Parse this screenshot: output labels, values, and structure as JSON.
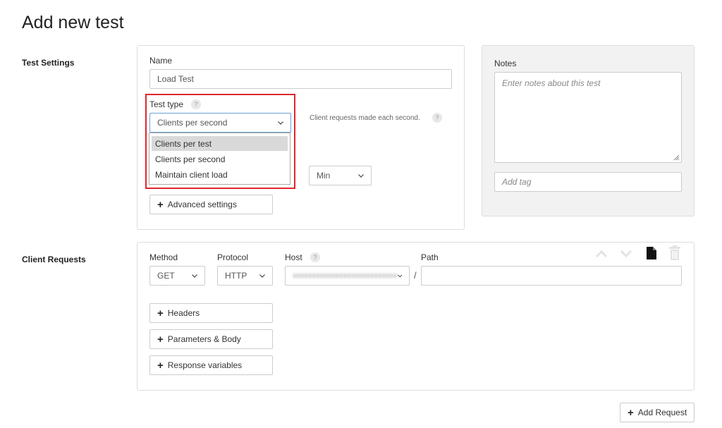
{
  "page": {
    "title": "Add new test"
  },
  "test_settings": {
    "section_label": "Test Settings",
    "name_label": "Name",
    "name_value": "Load Test",
    "test_type_label": "Test type",
    "test_type_help": "?",
    "test_type_selected": "Clients per second",
    "test_type_options": [
      "Clients per test",
      "Clients per second",
      "Maintain client load"
    ],
    "test_type_highlighted_option": "Clients per test",
    "hint": "Client requests made each second.",
    "hint_help": "?",
    "duration_unit_selected": "Min",
    "advanced_settings_label": "Advanced settings"
  },
  "notes": {
    "label": "Notes",
    "placeholder": "Enter notes about this test",
    "tag_placeholder": "Add tag"
  },
  "client_requests": {
    "section_label": "Client Requests",
    "method_label": "Method",
    "method_selected": "GET",
    "protocol_label": "Protocol",
    "protocol_selected": "HTTP",
    "host_label": "Host",
    "host_help": "?",
    "host_selected": "xxxxxxxxxxxxxxxxxxxxxxxxxxx",
    "separator": "/",
    "path_label": "Path",
    "path_value": "",
    "headers_label": "Headers",
    "params_body_label": "Parameters & Body",
    "response_variables_label": "Response variables",
    "icons": [
      "chevron-up-icon",
      "chevron-down-icon",
      "document-icon",
      "trash-icon"
    ]
  },
  "footer": {
    "add_request_label": "Add Request"
  },
  "colors": {
    "highlight_border": "#e0262b",
    "focus_border": "#6b9fd6",
    "notes_panel_bg": "#f2f2f2",
    "selected_option_bg": "#d9d9d9"
  }
}
